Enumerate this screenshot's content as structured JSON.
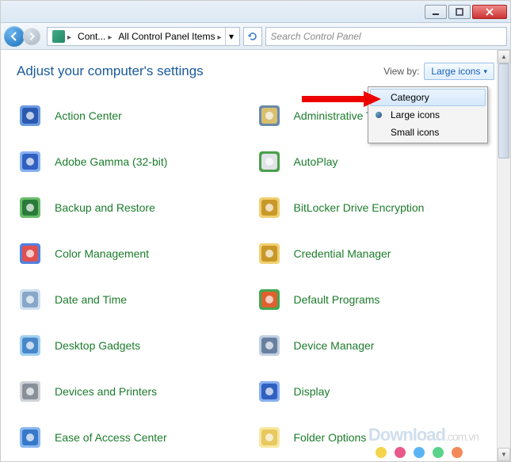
{
  "window": {
    "minimize_tip": "Minimize",
    "maximize_tip": "Maximize",
    "close_tip": "Close"
  },
  "nav": {
    "breadcrumb": [
      {
        "label": "Cont..."
      },
      {
        "label": "All Control Panel Items"
      }
    ],
    "search_placeholder": "Search Control Panel"
  },
  "page": {
    "heading": "Adjust your computer's settings",
    "viewby_label": "View by:",
    "viewby_value": "Large icons"
  },
  "dropdown": {
    "items": [
      {
        "label": "Category",
        "selected": false,
        "hover": true
      },
      {
        "label": "Large icons",
        "selected": true,
        "hover": false
      },
      {
        "label": "Small icons",
        "selected": false,
        "hover": false
      }
    ]
  },
  "items": [
    {
      "label": "Action Center",
      "icon": "flag",
      "c1": "#2a5ab0",
      "c2": "#6a9ae0"
    },
    {
      "label": "Administrative Tools",
      "icon": "tools",
      "c1": "#d8c070",
      "c2": "#6a8aa8"
    },
    {
      "label": "Adobe Gamma (32-bit)",
      "icon": "monitor",
      "c1": "#3060c0",
      "c2": "#88b0f0"
    },
    {
      "label": "AutoPlay",
      "icon": "autoplay",
      "c1": "#e0e4e8",
      "c2": "#4aa04a"
    },
    {
      "label": "Backup and Restore",
      "icon": "backup",
      "c1": "#2a7a3a",
      "c2": "#6abc6a"
    },
    {
      "label": "BitLocker Drive Encryption",
      "icon": "lock",
      "c1": "#c89828",
      "c2": "#f0d070"
    },
    {
      "label": "Color Management",
      "icon": "color",
      "c1": "#e05050",
      "c2": "#5080e0"
    },
    {
      "label": "Credential Manager",
      "icon": "safe",
      "c1": "#c89828",
      "c2": "#f0d070"
    },
    {
      "label": "Date and Time",
      "icon": "clock",
      "c1": "#88a8c8",
      "c2": "#d0e0f0"
    },
    {
      "label": "Default Programs",
      "icon": "defaults",
      "c1": "#e06030",
      "c2": "#40a850"
    },
    {
      "label": "Desktop Gadgets",
      "icon": "gadgets",
      "c1": "#4888c8",
      "c2": "#a0d0f0"
    },
    {
      "label": "Device Manager",
      "icon": "device",
      "c1": "#6880a0",
      "c2": "#c0d0e0"
    },
    {
      "label": "Devices and Printers",
      "icon": "printer",
      "c1": "#889098",
      "c2": "#d0d4d8"
    },
    {
      "label": "Display",
      "icon": "display",
      "c1": "#3060c0",
      "c2": "#88b0f0"
    },
    {
      "label": "Ease of Access Center",
      "icon": "access",
      "c1": "#3878c8",
      "c2": "#8ab8f0"
    },
    {
      "label": "Folder Options",
      "icon": "folder",
      "c1": "#e8c860",
      "c2": "#f8e8a0"
    }
  ],
  "watermark": {
    "brand": "Download",
    "suffix": ".com.vn"
  },
  "dot_colors": [
    "#f4d44a",
    "#e85a8a",
    "#5ab4f4",
    "#5ad48a",
    "#f48a5a"
  ]
}
